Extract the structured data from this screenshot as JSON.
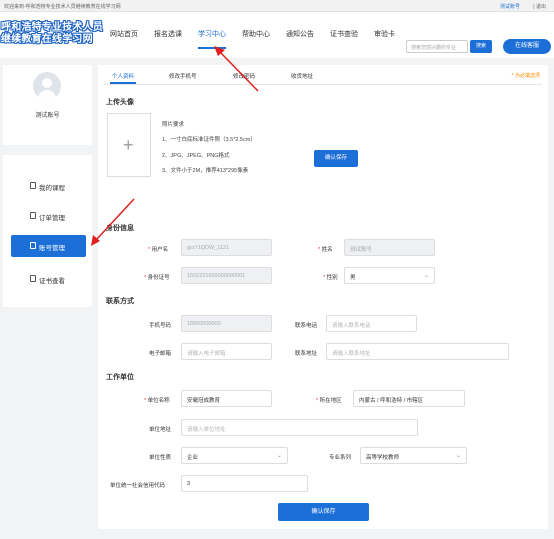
{
  "topbar": {
    "welcome": "欢迎来到-呼和浩特专业技术人员继续教育在线学习网",
    "account": "测试账号",
    "exit": "| 退出"
  },
  "logo": {
    "line1": "呼和浩特专业技术人员",
    "line2": "继续教育在线学习网"
  },
  "nav": {
    "items": [
      "网站首页",
      "报名选课",
      "学习中心",
      "帮助中心",
      "通知公告",
      "证书查验",
      "审验卡"
    ],
    "active_index": 2
  },
  "search": {
    "placeholder": "搜索您感兴趣的专业",
    "button": "搜索"
  },
  "service_button": "在线客服",
  "profile": {
    "name": "测试账号"
  },
  "sidebar": {
    "items": [
      {
        "label": "我的课程"
      },
      {
        "label": "订单管理"
      },
      {
        "label": "账号管理"
      },
      {
        "label": "证书查看"
      }
    ],
    "active_index": 2
  },
  "tabs": {
    "items": [
      "个人资料",
      "修改手机号",
      "修改密码",
      "收货地址"
    ],
    "active_index": 0
  },
  "required_note": "* 为必填选项",
  "upload": {
    "title": "上传头像",
    "req_title": "照片要求",
    "req1": "1、一寸白底标准证件照（3.5*2.5cm）",
    "req2": "2、JPG、JPEG、PNG格式",
    "req3": "3、文件小于2M，推荐413*295像素",
    "confirm": "确认保存"
  },
  "identity": {
    "title": "身份信息",
    "username_label": "用户名",
    "username_value": "gcr71QDW_1121",
    "name_label": "姓名",
    "name_value": "测试账号",
    "idcard_label": "身份证号",
    "idcard_value": "1502221999000000001",
    "gender_label": "性别",
    "gender_value": "男"
  },
  "contact": {
    "title": "联系方式",
    "phone_label": "手机号码",
    "phone_value": "18800000000",
    "tel_label": "联系电话",
    "tel_placeholder": "请输入联系电话",
    "email_label": "电子邮箱",
    "email_placeholder": "请输入电子邮箱",
    "address_label": "联系地址",
    "address_placeholder": "请输入联系地址"
  },
  "work": {
    "title": "工作单位",
    "unit_label": "单位名称",
    "unit_value": "安徽冠成教育",
    "region_label": "所在地区",
    "region_value": "内蒙古 / 呼和浩特 / 市辖区",
    "unit_addr_label": "单位地址",
    "unit_addr_placeholder": "请输入单位地址",
    "unit_type_label": "单位性质",
    "unit_type_value": "企业",
    "series_label": "专业系列",
    "series_value": "高等学校教师",
    "credit_label": "单位统一社会信用代码",
    "credit_value": "3"
  },
  "save_button": "确认保存",
  "colors": {
    "accent": "#1d6fd8",
    "required": "#e33333",
    "note": "#ff8a00",
    "annotation_arrow": "#e02020"
  }
}
